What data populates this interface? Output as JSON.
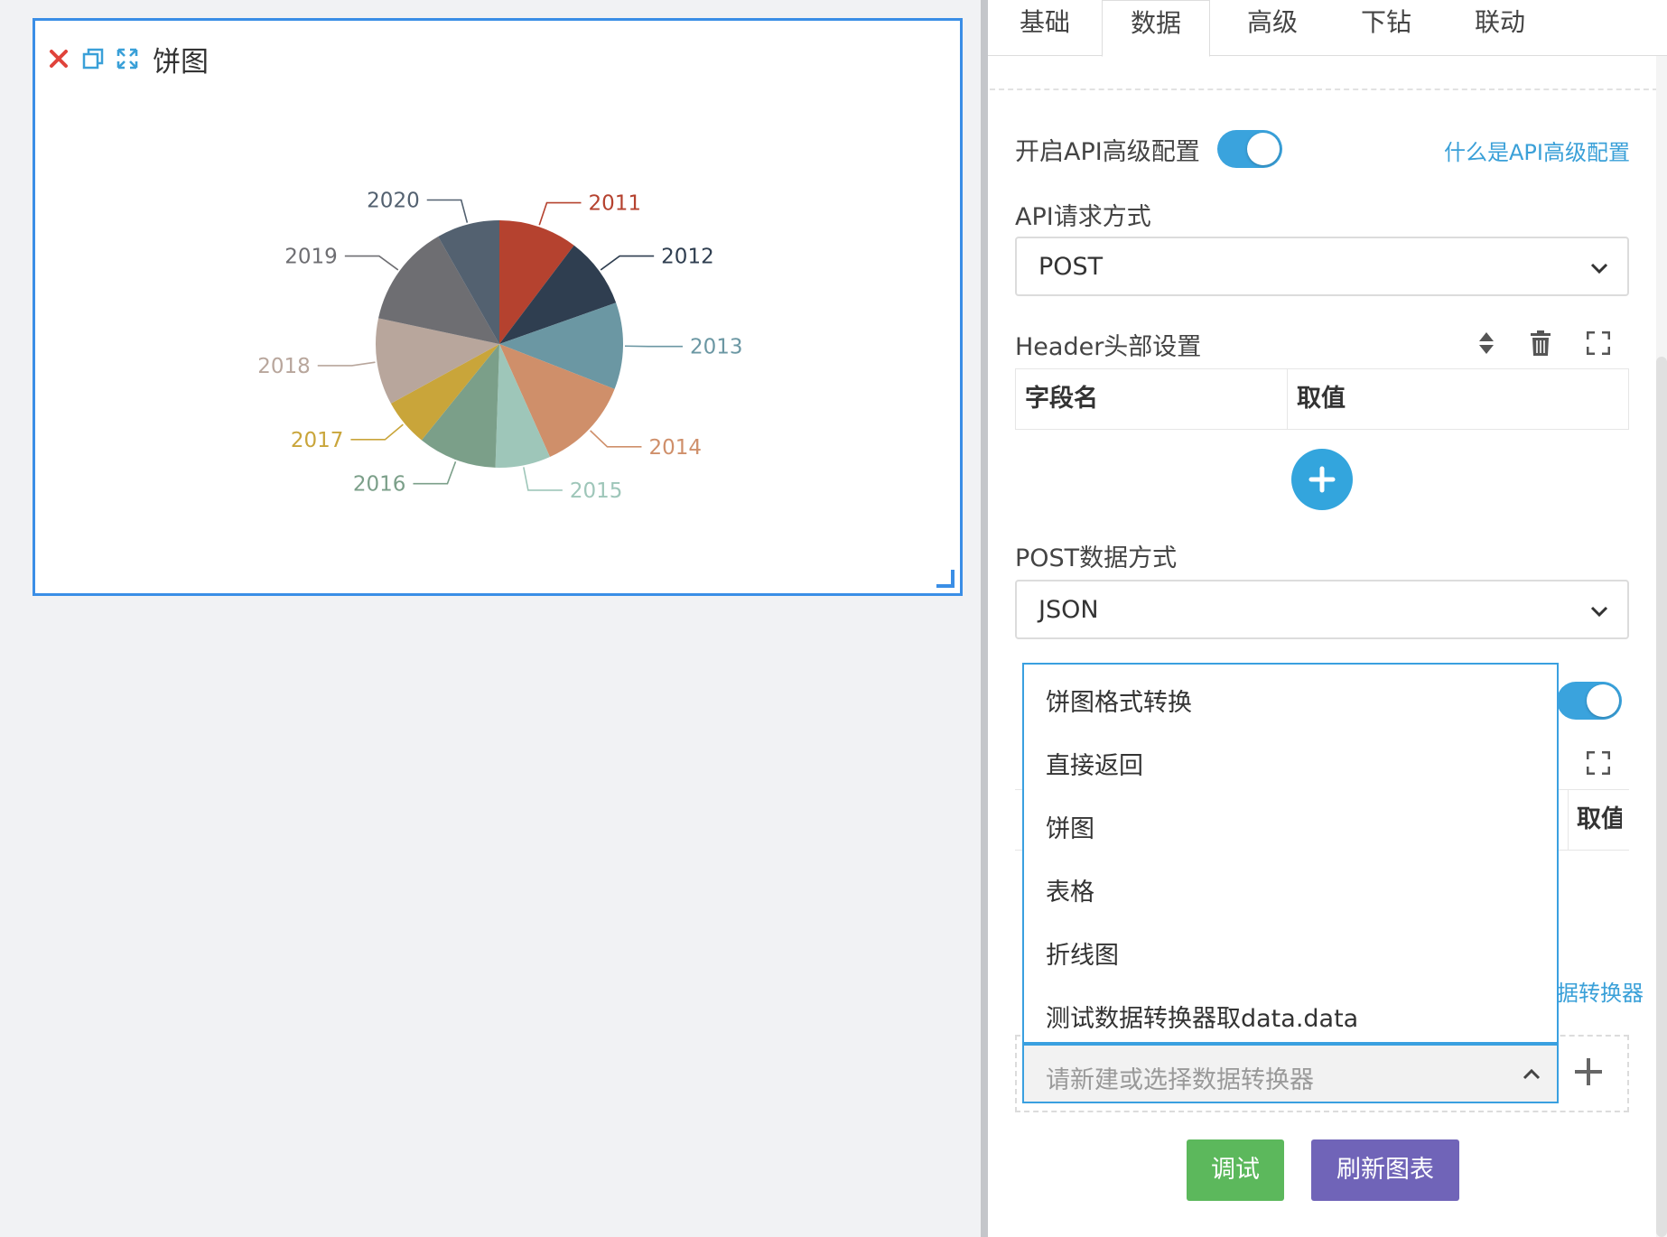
{
  "widget": {
    "title": "饼图"
  },
  "chart_data": {
    "type": "pie",
    "categories": [
      "2011",
      "2012",
      "2013",
      "2014",
      "2015",
      "2016",
      "2017",
      "2018",
      "2019",
      "2020"
    ],
    "values": [
      10,
      9,
      11,
      12,
      7,
      10,
      6,
      11,
      13,
      8
    ],
    "colors": [
      "#b5422f",
      "#2f3e50",
      "#6b97a3",
      "#cf8f6a",
      "#9ec6b9",
      "#7b9f89",
      "#c9a53a",
      "#b8a69c",
      "#6e6e72",
      "#536170"
    ]
  },
  "tabs": [
    {
      "label": "基础"
    },
    {
      "label": "数据"
    },
    {
      "label": "高级"
    },
    {
      "label": "下钻"
    },
    {
      "label": "联动"
    }
  ],
  "api": {
    "advanced_label": "开启API高级配置",
    "advanced_help": "什么是API高级配置",
    "method_label": "API请求方式",
    "method_value": "POST",
    "header_label": "Header头部设置",
    "header_col_name": "字段名",
    "header_col_value": "取值",
    "post_mode_label": "POST数据方式",
    "post_mode_value": "JSON",
    "param_col_value": "取值",
    "converter_help": "据转换器",
    "converter_placeholder": "请新建或选择数据转换器"
  },
  "dropdown": {
    "options": [
      "饼图格式转换",
      "直接返回",
      "饼图",
      "表格",
      "折线图",
      "测试数据转换器取data.data"
    ]
  },
  "buttons": {
    "debug": "调试",
    "refresh": "刷新图表"
  }
}
